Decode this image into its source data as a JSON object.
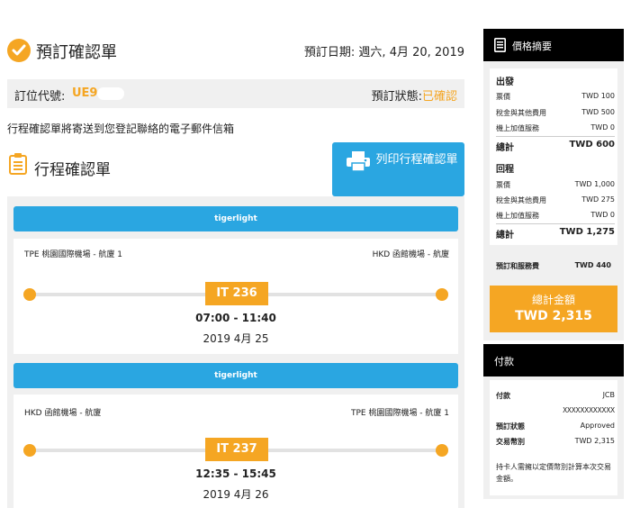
{
  "header": {
    "title": "預訂確認單",
    "booking_date": "預訂日期: 週六, 4月 20, 2019"
  },
  "reference": {
    "label": "訂位代號:",
    "code": "UE9",
    "status_label": "預訂狀態:",
    "status_value": "已確認"
  },
  "email_note": "行程確認單將寄送到您登記聯絡的電子郵件信箱",
  "itinerary": {
    "title": "行程確認單",
    "print_label": "列印行程確認單"
  },
  "segments": [
    {
      "airline": "tigerlight",
      "from": "TPE 桃園國際機場 - 航廈 1",
      "to": "HKD 函館機場 - 航廈",
      "flight_no": "IT 236",
      "times": "07:00 - 11:40",
      "date": "2019 4月 25"
    },
    {
      "airline": "tigerlight",
      "from": "HKD 函館機場 - 航廈",
      "to": "TPE 桃園國際機場 - 航廈 1",
      "flight_no": "IT 237",
      "times": "12:35 - 15:45",
      "date": "2019 4月 26"
    }
  ],
  "summary": {
    "title": "價格摘要",
    "outbound": {
      "title": "出發",
      "fare_label": "票價",
      "fare": "TWD 100",
      "tax_label": "稅金與其他費用",
      "tax": "TWD 500",
      "addon_label": "機上加值服務",
      "addon": "TWD 0",
      "total_label": "總計",
      "total": "TWD 600"
    },
    "return": {
      "title": "回程",
      "fare_label": "票價",
      "fare": "TWD 1,000",
      "tax_label": "稅金與其他費用",
      "tax": "TWD 275",
      "addon_label": "機上加值服務",
      "addon": "TWD 0",
      "total_label": "總計",
      "total": "TWD 1,275"
    },
    "fee_label": "預訂和服務費",
    "fee": "TWD 440",
    "grand_label": "總計金額",
    "grand_total": "TWD 2,315"
  },
  "payment": {
    "title": "付款",
    "method_label": "付款",
    "method": "JCB",
    "card_number": "XXXXXXXXXXXX",
    "status_label": "預訂狀態",
    "status": "Approved",
    "currency_label": "交易幣別",
    "amount": "TWD 2,315",
    "note": "持卡人需擁以定價幣別計算本次交易金額。"
  },
  "colors": {
    "accent": "#f5a623",
    "primary": "#2aa6e1",
    "panel_bg": "#f0f0f0",
    "header_bg": "#000000"
  }
}
